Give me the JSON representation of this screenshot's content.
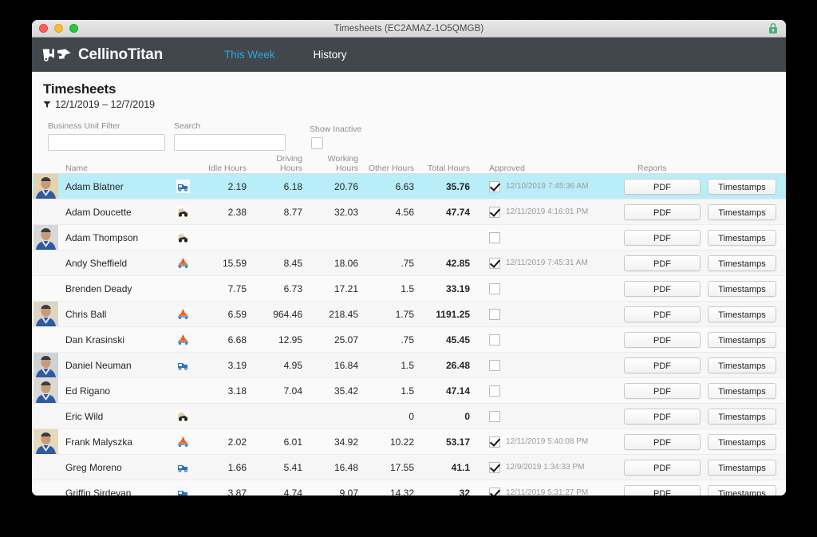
{
  "window": {
    "title": "Timesheets (EC2AMAZ-1O5QMGB)",
    "lock_icon": "green-lock-icon"
  },
  "navbar": {
    "logo_text": "CellinoTitan",
    "logo_icon": "cement-truck-logo-icon",
    "links": [
      {
        "label": "This Week",
        "active": true
      },
      {
        "label": "History",
        "active": false
      }
    ],
    "active_color": "#29abe2",
    "background": "#41474c"
  },
  "page": {
    "title": "Timesheets",
    "filter_icon": "funnel-icon",
    "date_range": "12/1/2019 – 12/7/2019"
  },
  "filters": {
    "business_unit": {
      "label": "Business Unit Filter",
      "value": "",
      "placeholder": ""
    },
    "search": {
      "label": "Search",
      "value": "",
      "placeholder": ""
    },
    "show_inactive": {
      "label": "Show Inactive",
      "checked": false
    }
  },
  "table": {
    "columns": [
      "Name",
      "Idle Hours",
      "Driving Hours",
      "Working Hours",
      "Other Hours",
      "Total Hours",
      "Approved",
      "Reports"
    ],
    "buttons": {
      "pdf": "PDF",
      "timestamps": "Timestamps"
    },
    "selected_row_color": "#b9edf8",
    "rows": [
      {
        "name": "Adam Blatner",
        "avatar": true,
        "vehicle_icon": "blue-truck-icon",
        "idle": "2.19",
        "driving": "6.18",
        "working": "20.76",
        "other": "6.63",
        "total": "35.76",
        "approved": true,
        "approved_at": "12/10/2019 7:45:36 AM",
        "selected": true
      },
      {
        "name": "Adam Doucette",
        "avatar": false,
        "vehicle_icon": "black-loader-icon",
        "idle": "2.38",
        "driving": "8.77",
        "working": "32.03",
        "other": "4.56",
        "total": "47.74",
        "approved": true,
        "approved_at": "12/11/2019 4:16:01 PM",
        "selected": false
      },
      {
        "name": "Adam Thompson",
        "avatar": true,
        "vehicle_icon": "black-loader-icon",
        "idle": "",
        "driving": "",
        "working": "",
        "other": "",
        "total": "",
        "approved": false,
        "approved_at": "",
        "selected": false
      },
      {
        "name": "Andy Sheffield",
        "avatar": false,
        "vehicle_icon": "orange-mixer-icon",
        "idle": "15.59",
        "driving": "8.45",
        "working": "18.06",
        "other": ".75",
        "total": "42.85",
        "approved": true,
        "approved_at": "12/11/2019 7:45:31 AM",
        "selected": false
      },
      {
        "name": "Brenden Deady",
        "avatar": false,
        "vehicle_icon": "",
        "idle": "7.75",
        "driving": "6.73",
        "working": "17.21",
        "other": "1.5",
        "total": "33.19",
        "approved": false,
        "approved_at": "",
        "selected": false
      },
      {
        "name": "Chris Ball",
        "avatar": true,
        "vehicle_icon": "orange-mixer-icon",
        "idle": "6.59",
        "driving": "964.46",
        "working": "218.45",
        "other": "1.75",
        "total": "1191.25",
        "approved": false,
        "approved_at": "",
        "selected": false
      },
      {
        "name": "Dan Krasinski",
        "avatar": false,
        "vehicle_icon": "orange-mixer-icon",
        "idle": "6.68",
        "driving": "12.95",
        "working": "25.07",
        "other": ".75",
        "total": "45.45",
        "approved": false,
        "approved_at": "",
        "selected": false
      },
      {
        "name": "Daniel Neuman",
        "avatar": true,
        "vehicle_icon": "blue-truck-icon",
        "idle": "3.19",
        "driving": "4.95",
        "working": "16.84",
        "other": "1.5",
        "total": "26.48",
        "approved": false,
        "approved_at": "",
        "selected": false
      },
      {
        "name": "Ed Rigano",
        "avatar": true,
        "vehicle_icon": "",
        "idle": "3.18",
        "driving": "7.04",
        "working": "35.42",
        "other": "1.5",
        "total": "47.14",
        "approved": false,
        "approved_at": "",
        "selected": false
      },
      {
        "name": "Eric Wild",
        "avatar": false,
        "vehicle_icon": "black-loader-icon",
        "idle": "",
        "driving": "",
        "working": "",
        "other": "0",
        "total": "0",
        "approved": false,
        "approved_at": "",
        "selected": false
      },
      {
        "name": "Frank Malyszka",
        "avatar": true,
        "vehicle_icon": "orange-mixer-icon",
        "idle": "2.02",
        "driving": "6.01",
        "working": "34.92",
        "other": "10.22",
        "total": "53.17",
        "approved": true,
        "approved_at": "12/11/2019 5:40:08 PM",
        "selected": false
      },
      {
        "name": "Greg Moreno",
        "avatar": false,
        "vehicle_icon": "blue-truck-icon",
        "idle": "1.66",
        "driving": "5.41",
        "working": "16.48",
        "other": "17.55",
        "total": "41.1",
        "approved": true,
        "approved_at": "12/9/2019 1:34:33 PM",
        "selected": false
      },
      {
        "name": "Griffin Sirdevan",
        "avatar": false,
        "vehicle_icon": "blue-truck-icon",
        "idle": "3.87",
        "driving": "4.74",
        "working": "9.07",
        "other": "14.32",
        "total": "32",
        "approved": true,
        "approved_at": "12/11/2019 5:31:27 PM",
        "selected": false
      }
    ]
  }
}
